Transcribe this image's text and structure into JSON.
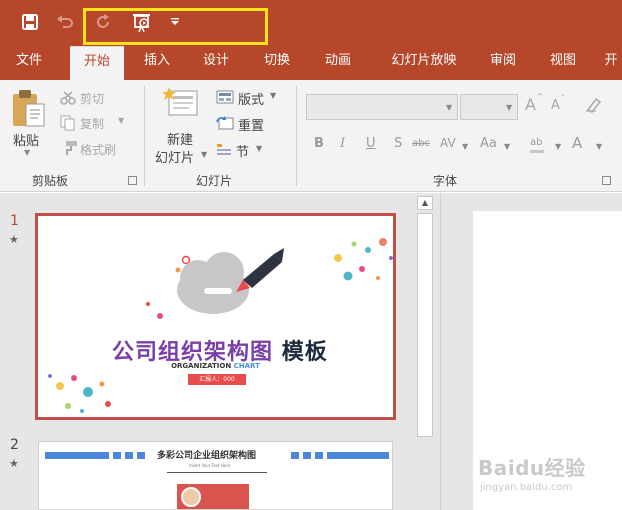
{
  "titlebar": {
    "quick_access": [
      "save-icon",
      "undo-icon",
      "redo-icon",
      "start-from-beginning-icon",
      "customize-quick-access-icon"
    ],
    "accent": "#b7472a",
    "highlight_color": "#ffe21a"
  },
  "tabs": [
    {
      "label": "文件",
      "active": false
    },
    {
      "label": "开始",
      "active": true
    },
    {
      "label": "插入",
      "active": false
    },
    {
      "label": "设计",
      "active": false
    },
    {
      "label": "切换",
      "active": false
    },
    {
      "label": "动画",
      "active": false
    },
    {
      "label": "幻灯片放映",
      "active": false
    },
    {
      "label": "审阅",
      "active": false
    },
    {
      "label": "视图",
      "active": false
    },
    {
      "label": "开",
      "active": false
    }
  ],
  "ribbon": {
    "clipboard": {
      "paste_label": "粘贴",
      "cut_label": "剪切",
      "copy_label": "复制",
      "format_painter_label": "格式刷",
      "group_label": "剪贴板"
    },
    "slides": {
      "new_slide_label_line1": "新建",
      "new_slide_label_line2": "幻灯片",
      "layout_label": "版式",
      "reset_label": "重置",
      "section_label": "节",
      "group_label": "幻灯片"
    },
    "font": {
      "group_label": "字体",
      "font_name_value": "",
      "font_size_value": "",
      "increase_size": "A",
      "decrease_size": "A",
      "bold": "B",
      "italic": "I",
      "underline": "U",
      "shadow": "S",
      "strikethrough": "abc",
      "char_spacing": "AV",
      "change_case": "Aa",
      "highlight": "ab",
      "font_color": "A"
    }
  },
  "thumbnails": [
    {
      "number": "1",
      "title_main": "公司组织架构图",
      "title_tail": "模板",
      "subtitle_part1": "ORGANIZATION",
      "subtitle_part2": "CHART",
      "badge": "汇报人：000"
    },
    {
      "number": "2",
      "title": "多彩公司企业组织架构图",
      "subtitle": "Insert Your Text Here"
    }
  ],
  "watermark": {
    "brand": "Baidu经验",
    "url": "jingyan.baidu.com"
  }
}
